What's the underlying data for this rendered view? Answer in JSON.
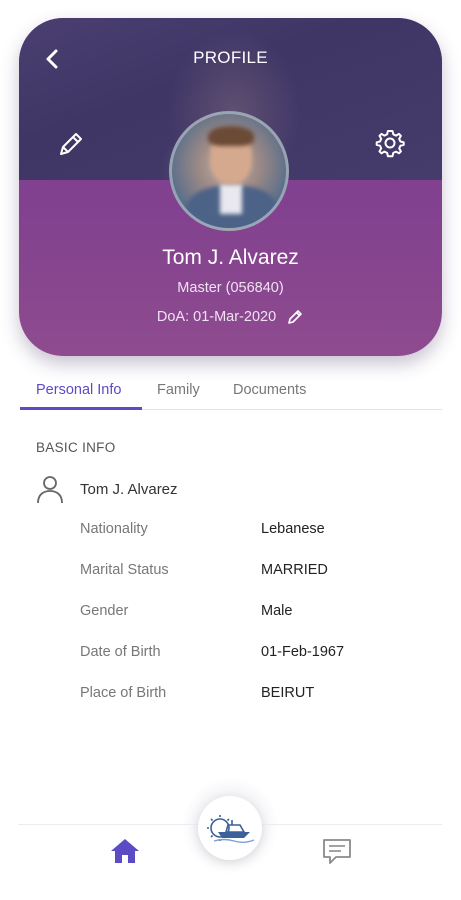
{
  "header": {
    "title": "PROFILE",
    "name": "Tom J. Alvarez",
    "rank": "Master (056840)",
    "doa": "DoA: 01-Mar-2020"
  },
  "tabs": [
    {
      "label": "Personal Info",
      "active": true
    },
    {
      "label": "Family",
      "active": false
    },
    {
      "label": "Documents",
      "active": false
    }
  ],
  "basic_info": {
    "section_title": "BASIC INFO",
    "full_name": "Tom J. Alvarez",
    "fields": [
      {
        "label": "Nationality",
        "value": "Lebanese"
      },
      {
        "label": "Marital Status",
        "value": "MARRIED"
      },
      {
        "label": "Gender",
        "value": "Male"
      },
      {
        "label": "Date of Birth",
        "value": "01-Feb-1967"
      },
      {
        "label": "Place of Birth",
        "value": "BEIRUT"
      }
    ]
  },
  "icons": {
    "back": "chevron-left-icon",
    "edit": "pencil-icon",
    "settings": "gear-icon",
    "person": "person-icon",
    "home": "home-icon",
    "messages": "chat-icon",
    "center": "ship-gear-logo-icon"
  },
  "colors": {
    "accent": "#5b4bc4",
    "header_purple": "#82418f",
    "header_dark": "#43396a"
  }
}
